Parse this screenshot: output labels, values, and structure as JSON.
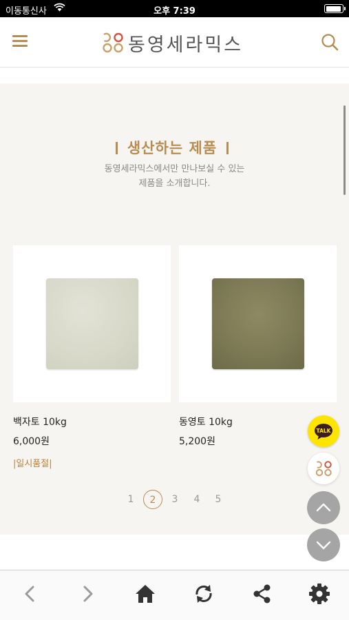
{
  "status_bar": {
    "carrier": "이동통신사",
    "time": "오후 7:39"
  },
  "header": {
    "brand": "동영세라믹스",
    "menu_icon": "hamburger-menu-icon",
    "search_icon": "search-icon"
  },
  "section": {
    "title": "생산하는 제품",
    "subtitle_line1": "동영세라믹스에서만 만나보실 수 있는",
    "subtitle_line2": "제품을 소개합니다."
  },
  "products": [
    {
      "name": "백자토 10kg",
      "price": "6,000원",
      "badge": "|일시품절|"
    },
    {
      "name": "동영토 10kg",
      "price": "5,200원",
      "badge": ""
    }
  ],
  "pagination": {
    "pages": [
      "1",
      "2",
      "3",
      "4",
      "5"
    ],
    "current": "2"
  },
  "floating": {
    "kakao_label": "TALK"
  },
  "colors": {
    "accent": "#b88c4f",
    "badge": "#c0803c",
    "kakao": "#fee500",
    "background": "#f7f5f1"
  }
}
